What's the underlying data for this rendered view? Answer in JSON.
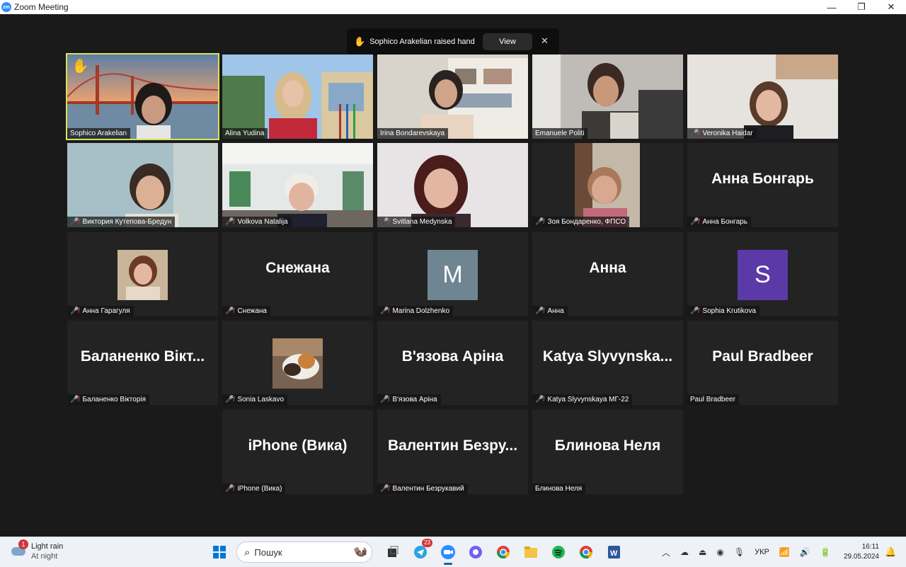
{
  "window": {
    "title": "Zoom Meeting",
    "app_icon_text": "zm"
  },
  "notification": {
    "text": "Sophico Arakelian raised hand",
    "view_label": "View",
    "close_label": "✕"
  },
  "participants": [
    {
      "name": "Sophico Arakelian",
      "mic_muted": false,
      "active": true,
      "hand_raised": true
    },
    {
      "name": "Alina Yudina",
      "mic_muted": false
    },
    {
      "name": "Irina Bondarevskaya",
      "mic_muted": false
    },
    {
      "name": "Emanuele Politi",
      "mic_muted": false
    },
    {
      "name": "Veronika Haidar",
      "mic_muted": true
    },
    {
      "name": "Виктория Кутепова-Бредун",
      "mic_muted": true
    },
    {
      "name": "Volkova Natalija",
      "mic_muted": true
    },
    {
      "name": "Svitlana Medynska",
      "mic_muted": true
    },
    {
      "name": "Зоя Бондаренко, ФПСО",
      "mic_muted": true
    },
    {
      "name": "Анна Бонгарь",
      "mic_muted": true,
      "display": "Анна Бонгарь"
    },
    {
      "name": "Анна Гарагуля",
      "mic_muted": true
    },
    {
      "name": "Снежана",
      "mic_muted": true,
      "display": "Снежана"
    },
    {
      "name": "Marina Dolzhenko",
      "mic_muted": true,
      "avatar_letter": "M",
      "avatar_color": "#6f8591"
    },
    {
      "name": "Анна",
      "mic_muted": true,
      "display": "Анна"
    },
    {
      "name": "Sophia Krutikova",
      "mic_muted": true,
      "avatar_letter": "S",
      "avatar_color": "#5b3aa8"
    },
    {
      "name": "Баланенко Вікторія",
      "mic_muted": true,
      "display": "Баланенко  Вікт..."
    },
    {
      "name": "Sonia Laskavo",
      "mic_muted": true
    },
    {
      "name": "В'язова Аріна",
      "mic_muted": true,
      "display": "В'язова Аріна"
    },
    {
      "name": "Katya Slyvynskaya МГ-22",
      "mic_muted": true,
      "display": "Katya  Slyvynska..."
    },
    {
      "name": "Paul Bradbeer",
      "mic_muted": false,
      "display": "Paul Bradbeer"
    },
    {
      "name": "iPhone (Вика)",
      "mic_muted": true,
      "display": "iPhone (Вика)"
    },
    {
      "name": "Валентин Безрукавий",
      "mic_muted": true,
      "display": "Валентин  Безру..."
    },
    {
      "name": "Блинова Неля",
      "mic_muted": false,
      "display": "Блинова Неля"
    }
  ],
  "taskbar": {
    "weather": {
      "title": "Light rain",
      "subtitle": "At night",
      "badge": "1"
    },
    "search_placeholder": "Пошук",
    "telegram_badge": "23",
    "language": "УКР",
    "time": "16:11",
    "date": "29.05.2024"
  },
  "colors": {
    "active_border": "#d8e25a",
    "muted_mic": "#e03a3a",
    "zoom_blue": "#2d8cff"
  }
}
